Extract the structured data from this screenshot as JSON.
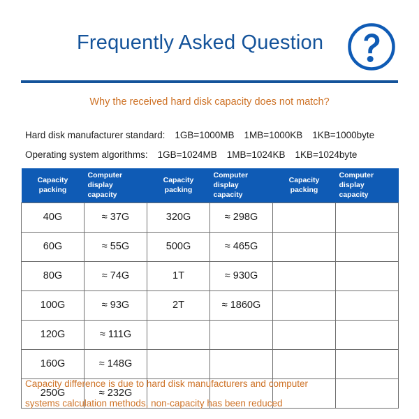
{
  "header": {
    "title": "Frequently Asked Question",
    "badge_icon": "question-mark-circle-icon",
    "accent_blue": "#14539A",
    "header_blue": "#0F5BB5",
    "accent_orange": "#CE7226"
  },
  "subtitle": {
    "text": "Why the received hard disk capacity does not match?"
  },
  "standards": [
    {
      "label": "Hard disk manufacturer standard:",
      "values": [
        "1GB=1000MB",
        "1MB=1000KB",
        "1KB=1000byte"
      ]
    },
    {
      "label": "Operating system algorithms:",
      "values": [
        "1GB=1024MB",
        "1MB=1024KB",
        "1KB=1024byte"
      ]
    }
  ],
  "table": {
    "columns": [
      {
        "label": "Capacity packing",
        "align": "center"
      },
      {
        "label": "Computer display capacity",
        "align": "left"
      },
      {
        "label": "Capacity packing",
        "align": "center"
      },
      {
        "label": "Computer display capacity",
        "align": "left"
      },
      {
        "label": "Capacity packing",
        "align": "center"
      },
      {
        "label": "Computer display capacity",
        "align": "left"
      }
    ],
    "rows": [
      [
        "40G",
        "≈ 37G",
        "320G",
        "≈ 298G",
        "",
        ""
      ],
      [
        "60G",
        "≈ 55G",
        "500G",
        "≈ 465G",
        "",
        ""
      ],
      [
        "80G",
        "≈ 74G",
        "1T",
        "≈ 930G",
        "",
        ""
      ],
      [
        "100G",
        "≈ 93G",
        "2T",
        "≈ 1860G",
        "",
        ""
      ],
      [
        "120G",
        "≈ 111G",
        "",
        "",
        "",
        ""
      ],
      [
        "160G",
        "≈ 148G",
        "",
        "",
        "",
        ""
      ],
      [
        "250G",
        "≈ 232G",
        "",
        "",
        "",
        ""
      ]
    ]
  },
  "footer": {
    "line1": "Capacity difference is due to hard disk manufacturers and computer",
    "line2": "systems calculation methods, non-capacity has been reduced"
  }
}
